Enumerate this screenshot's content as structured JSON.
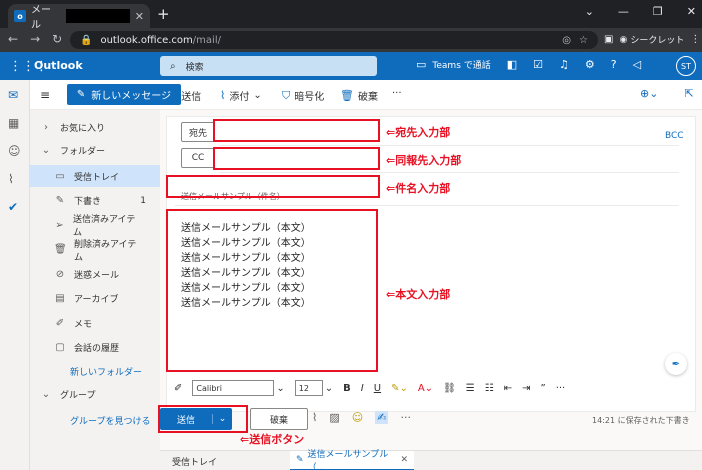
{
  "browser": {
    "tab_title": "メール",
    "new_tab": "+",
    "url_host": "outlook.office.com",
    "url_path": "/mail/",
    "incognito_label": "シークレット"
  },
  "outlook": {
    "brand": "Outlook",
    "search_placeholder": "検索",
    "teams_label": "Teams で通話",
    "avatar": "ST"
  },
  "toolbar": {
    "new_message": "新しいメッセージ",
    "send": "送信",
    "attach": "添付",
    "encrypt": "暗号化",
    "discard": "破棄",
    "more": "···"
  },
  "sidebar": {
    "favorites": "お気に入り",
    "folders": "フォルダー",
    "items": [
      {
        "label": "受信トレイ",
        "icon": "inbox-icon",
        "count": ""
      },
      {
        "label": "下書き",
        "icon": "draft-icon",
        "count": "1"
      },
      {
        "label": "送信済みアイテム",
        "icon": "sent-icon",
        "count": ""
      },
      {
        "label": "削除済みアイテム",
        "icon": "trash-icon",
        "count": ""
      },
      {
        "label": "迷惑メール",
        "icon": "junk-icon",
        "count": ""
      },
      {
        "label": "アーカイブ",
        "icon": "archive-icon",
        "count": ""
      },
      {
        "label": "メモ",
        "icon": "note-icon",
        "count": ""
      },
      {
        "label": "会話の履歴",
        "icon": "folder-icon",
        "count": ""
      }
    ],
    "new_folder": "新しいフォルダー",
    "groups": "グループ",
    "find_groups": "グループを見つける"
  },
  "compose": {
    "to_label": "宛先",
    "cc_label": "CC",
    "bcc_label": "BCC",
    "subject_value": "送信メールサンプル（件名）",
    "body_lines": [
      "送信メールサンプル（本文）",
      "送信メールサンプル（本文）",
      "送信メールサンプル（本文）",
      "送信メールサンプル（本文）",
      "送信メールサンプル（本文）",
      "送信メールサンプル（本文）"
    ],
    "font_name": "Calibri",
    "font_size": "12",
    "send_button": "送信",
    "discard_button": "破棄",
    "saved_status": "14:21 に保存された下書き"
  },
  "bottom_tabs": {
    "inbox": "受信トレイ",
    "draft": "送信メールサンプル（..."
  },
  "annotations": {
    "to": "⇐宛先入力部",
    "cc": "⇐同報先入力部",
    "subject": "⇐件名入力部",
    "body": "⇐本文入力部",
    "send": "⇐送信ボタン"
  },
  "colors": {
    "brand": "#0f6cbd",
    "annotation": "#e81123"
  }
}
